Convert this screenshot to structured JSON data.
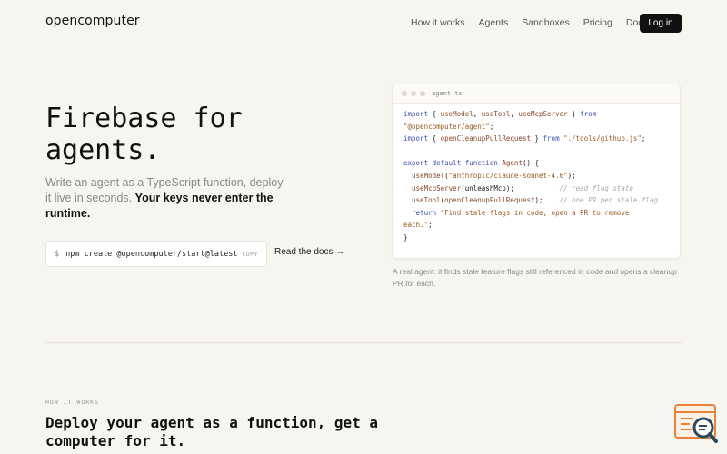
{
  "nav": {
    "logo": "opencomputer",
    "links": [
      "How it works",
      "Agents",
      "Sandboxes",
      "Pricing",
      "Docs"
    ],
    "login_label": "Log in"
  },
  "hero": {
    "title": "Firebase for agents.",
    "subtitle_muted": "Write an agent as a TypeScript function, deploy it live in seconds.",
    "subtitle_strong": "Your keys never enter the runtime.",
    "command_prompt": "$",
    "command": "npm create @opencomputer/start@latest",
    "copy_label": "COPY",
    "docs_link": "Read the docs →"
  },
  "code_card": {
    "filename": "agent.ts",
    "lines": [
      {
        "p": [
          [
            "k",
            "import"
          ],
          [
            "t",
            " { "
          ],
          [
            "f",
            "useModel"
          ],
          [
            "t",
            ", "
          ],
          [
            "f",
            "useTool"
          ],
          [
            "t",
            ", "
          ],
          [
            "f",
            "useMcpServer"
          ],
          [
            "t",
            " } "
          ],
          [
            "k",
            "from"
          ]
        ]
      },
      {
        "p": [
          [
            "s",
            "\"@opencomputer/agent\""
          ],
          [
            "t",
            ";"
          ]
        ]
      },
      {
        "p": [
          [
            "k",
            "import"
          ],
          [
            "t",
            " { "
          ],
          [
            "f",
            "openCleanupPullRequest"
          ],
          [
            "t",
            " } "
          ],
          [
            "k",
            "from"
          ],
          [
            "t",
            " "
          ],
          [
            "s",
            "\"./tools/github.js\""
          ],
          [
            "t",
            ";"
          ]
        ]
      },
      {
        "p": [
          [
            "t",
            ""
          ]
        ]
      },
      {
        "p": [
          [
            "k",
            "export default function"
          ],
          [
            "t",
            " "
          ],
          [
            "f",
            "Agent"
          ],
          [
            "t",
            "() {"
          ]
        ]
      },
      {
        "p": [
          [
            "t",
            "  "
          ],
          [
            "f",
            "useModel"
          ],
          [
            "t",
            "("
          ],
          [
            "s",
            "\"anthropic/claude-sonnet-4.6\""
          ],
          [
            "t",
            ");"
          ]
        ]
      },
      {
        "p": [
          [
            "t",
            "  "
          ],
          [
            "f",
            "useMcpServer"
          ],
          [
            "t",
            "(unleashMcp);           "
          ],
          [
            "c",
            "// read flag state"
          ]
        ]
      },
      {
        "p": [
          [
            "t",
            "  "
          ],
          [
            "f",
            "useTool"
          ],
          [
            "t",
            "("
          ],
          [
            "f",
            "openCleanupPullRequest"
          ],
          [
            "t",
            ");    "
          ],
          [
            "c",
            "// one PR per stale flag"
          ]
        ]
      },
      {
        "p": [
          [
            "t",
            "  "
          ],
          [
            "k",
            "return"
          ],
          [
            "t",
            " "
          ],
          [
            "s",
            "\"Find stale flags in code, open a PR to remove"
          ]
        ]
      },
      {
        "p": [
          [
            "s",
            "each.\""
          ],
          [
            "t",
            ";"
          ]
        ]
      },
      {
        "p": [
          [
            "t",
            "}"
          ]
        ]
      }
    ],
    "caption": "A real agent: it finds stale feature flags still referenced in code and opens a cleanup PR for each."
  },
  "how_it_works": {
    "label": "HOW IT WORKS",
    "title": "Deploy your agent as a function, get a computer for it."
  },
  "colors": {
    "background": "#f7f5f0",
    "login_button": "#111111",
    "code_keyword": "#3b4fa8",
    "code_string": "#9a5a20",
    "code_comment": "#a8a8a8",
    "corner_icon": "#e8823a"
  }
}
